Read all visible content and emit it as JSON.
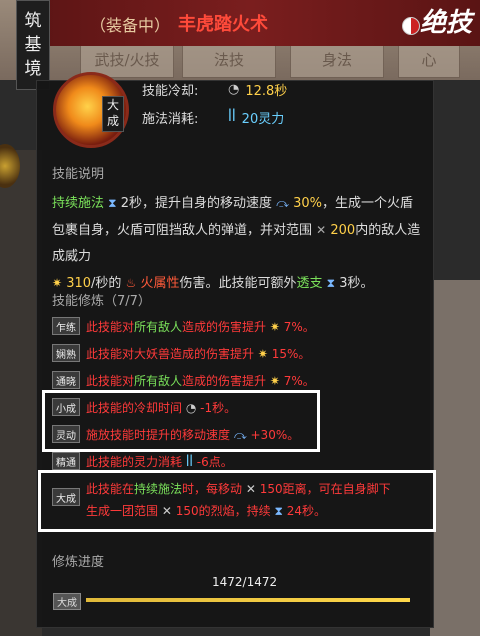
{
  "header": {
    "vertical_tab": [
      "筑",
      "基",
      "境"
    ],
    "equip_tag": "（装备中）",
    "skill_name": "丰虎踏火术",
    "logo": "绝技",
    "bg_tabs": [
      "武技/火技",
      "法技",
      "身法",
      "心"
    ]
  },
  "skill": {
    "rank_badge": "大成",
    "cooldown_label": "技能冷却:",
    "cooldown_value": "12.8秒",
    "cost_label": "施法消耗:",
    "cost_value": "20灵力"
  },
  "description": {
    "title": "技能说明",
    "p1_prefix_green": "持续施法",
    "p1_a": "2秒，提升自身的移动速度",
    "p1_b": "30%",
    "p1_c": "，生成一个火盾包裹自身，火盾可阻挡敌人的弹道，并对范围",
    "p1_d": "200",
    "p1_e": "内的敌人造成威力",
    "p1_f": "310",
    "p1_g": "/秒的",
    "p1_h": "火属性",
    "p1_i": "伤害。此技能可额外",
    "p1_j": "透支",
    "p1_k": "3秒。"
  },
  "cultivation": {
    "title": "技能修炼（7/7）",
    "rows": [
      {
        "level": "乍练",
        "text": "此技能对",
        "green": "所有敌人",
        "text2": "造成的伤害提升",
        "value": "7%。"
      },
      {
        "level": "娴熟",
        "text": "此技能对大妖兽造成的伤害提升",
        "green": "",
        "text2": "",
        "value": "15%。"
      },
      {
        "level": "通晓",
        "text": "此技能对",
        "green": "所有敌人",
        "text2": "造成的伤害提升",
        "value": "7%。"
      },
      {
        "level": "小成",
        "text": "此技能的冷却时间",
        "green": "",
        "text2": "",
        "value": "-1秒。"
      },
      {
        "level": "灵动",
        "text": "施放技能时提升的移动速度",
        "green": "",
        "text2": "",
        "value": "+30%。"
      },
      {
        "level": "精通",
        "text": "此技能的灵力消耗",
        "green": "",
        "text2": "",
        "value": "-6点。"
      }
    ],
    "big": {
      "level": "大成",
      "l1_a": "此技能在",
      "l1_green": "持续施法",
      "l1_b": "时，每移动",
      "l1_val": "150距离，可在自身脚下",
      "l2_a": "生成一团范围",
      "l2_val": "150的",
      "l2_red": "烈焰",
      "l2_b": "，持续",
      "l2_val2": "24秒。"
    }
  },
  "progress": {
    "title": "修炼进度",
    "value": "1472/1472",
    "tag": "大成",
    "fraction": 1.0
  },
  "colors": {
    "accent_red": "#ff3a3a",
    "accent_green": "#7ae05a",
    "accent_yellow": "#ffd04a"
  }
}
